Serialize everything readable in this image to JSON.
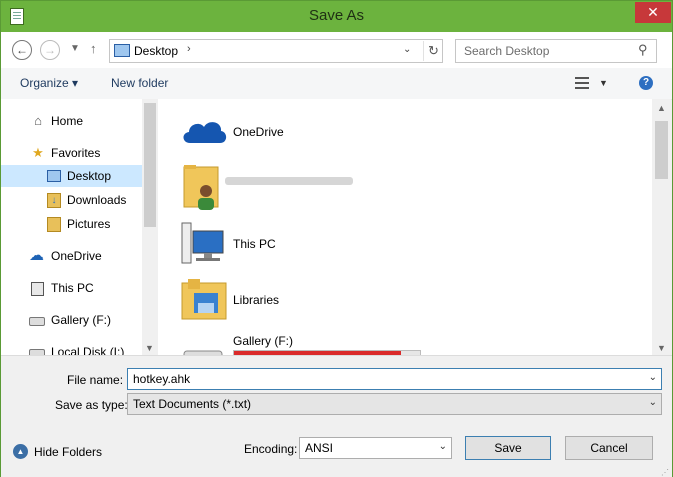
{
  "window": {
    "title": "Save As",
    "close_label": "✕"
  },
  "nav": {
    "address_path": "Desktop",
    "search_placeholder": "Search Desktop"
  },
  "toolbar": {
    "organize_label": "Organize ▾",
    "new_folder_label": "New folder"
  },
  "sidebar": {
    "items": [
      {
        "label": "Home",
        "icon": "home-icon",
        "selected": false
      },
      {
        "label": "Favorites",
        "icon": "star-icon",
        "selected": false
      },
      {
        "label": "Desktop",
        "icon": "desktop-icon",
        "selected": true
      },
      {
        "label": "Downloads",
        "icon": "downloads-icon",
        "selected": false
      },
      {
        "label": "Pictures",
        "icon": "pictures-icon",
        "selected": false
      },
      {
        "label": "OneDrive",
        "icon": "cloud-icon",
        "selected": false
      },
      {
        "label": "This PC",
        "icon": "computer-icon",
        "selected": false
      },
      {
        "label": "Gallery (F:)",
        "icon": "drive-icon",
        "selected": false
      },
      {
        "label": "Local Disk (I:)",
        "icon": "drive-icon",
        "selected": false
      }
    ]
  },
  "content": {
    "items": [
      {
        "label": "OneDrive",
        "icon": "cloud-icon"
      },
      {
        "label": "",
        "icon": "user-folder-icon"
      },
      {
        "label": "This PC",
        "icon": "computer-icon"
      },
      {
        "label": "Libraries",
        "icon": "libraries-icon"
      },
      {
        "label": "Gallery (F:)",
        "icon": "drive-icon",
        "usage_fraction": 0.9
      }
    ]
  },
  "form": {
    "file_name_label": "File name:",
    "file_name_value": "hotkey.ahk",
    "save_type_label": "Save as type:",
    "save_type_value": "Text Documents (*.txt)",
    "hide_folders_label": "Hide Folders",
    "encoding_label": "Encoding:",
    "encoding_value": "ANSI",
    "save_label": "Save",
    "cancel_label": "Cancel"
  },
  "colors": {
    "titlebar": "#6cb33e",
    "close": "#c7383a",
    "selection": "#cce8ff",
    "drive_bar": "#da2a2a"
  }
}
